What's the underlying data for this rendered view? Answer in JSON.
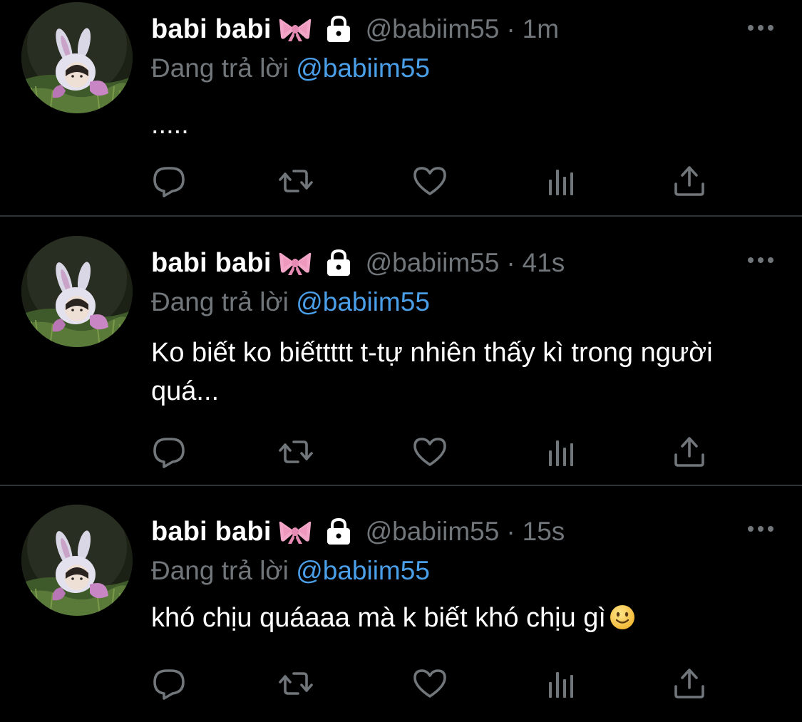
{
  "tweets": [
    {
      "display_name": "babi babi",
      "name_emoji": "ribbon",
      "protected_icon": "lock-icon",
      "handle": "@babiim55",
      "separator": "·",
      "time": "1m",
      "reply_prefix": "Đang trả lời",
      "reply_to": "@babiim55",
      "text": ".....",
      "actions": [
        "reply-icon",
        "retweet-icon",
        "like-icon",
        "views-icon",
        "share-icon"
      ]
    },
    {
      "display_name": "babi babi",
      "name_emoji": "ribbon",
      "protected_icon": "lock-icon",
      "handle": "@babiim55",
      "separator": "·",
      "time": "41s",
      "reply_prefix": "Đang trả lời",
      "reply_to": "@babiim55",
      "text": "Ko biết ko biếttttt t-tự nhiên thấy kì trong người quá...",
      "actions": [
        "reply-icon",
        "retweet-icon",
        "like-icon",
        "views-icon",
        "share-icon"
      ]
    },
    {
      "display_name": "babi babi",
      "name_emoji": "ribbon",
      "protected_icon": "lock-icon",
      "handle": "@babiim55",
      "separator": "·",
      "time": "15s",
      "reply_prefix": "Đang trả lời",
      "reply_to": "@babiim55",
      "text": "khó chịu quáaaa mà k biết khó chịu gì",
      "text_emoji": "slightly-smiling-face",
      "actions": [
        "reply-icon",
        "retweet-icon",
        "like-icon",
        "views-icon",
        "share-icon"
      ]
    }
  ],
  "colors": {
    "background": "#000000",
    "text_primary": "#ffffff",
    "text_secondary": "#71767b",
    "link": "#4a9fe8",
    "divider": "#2f3336",
    "ribbon": "#f4a6c9"
  }
}
